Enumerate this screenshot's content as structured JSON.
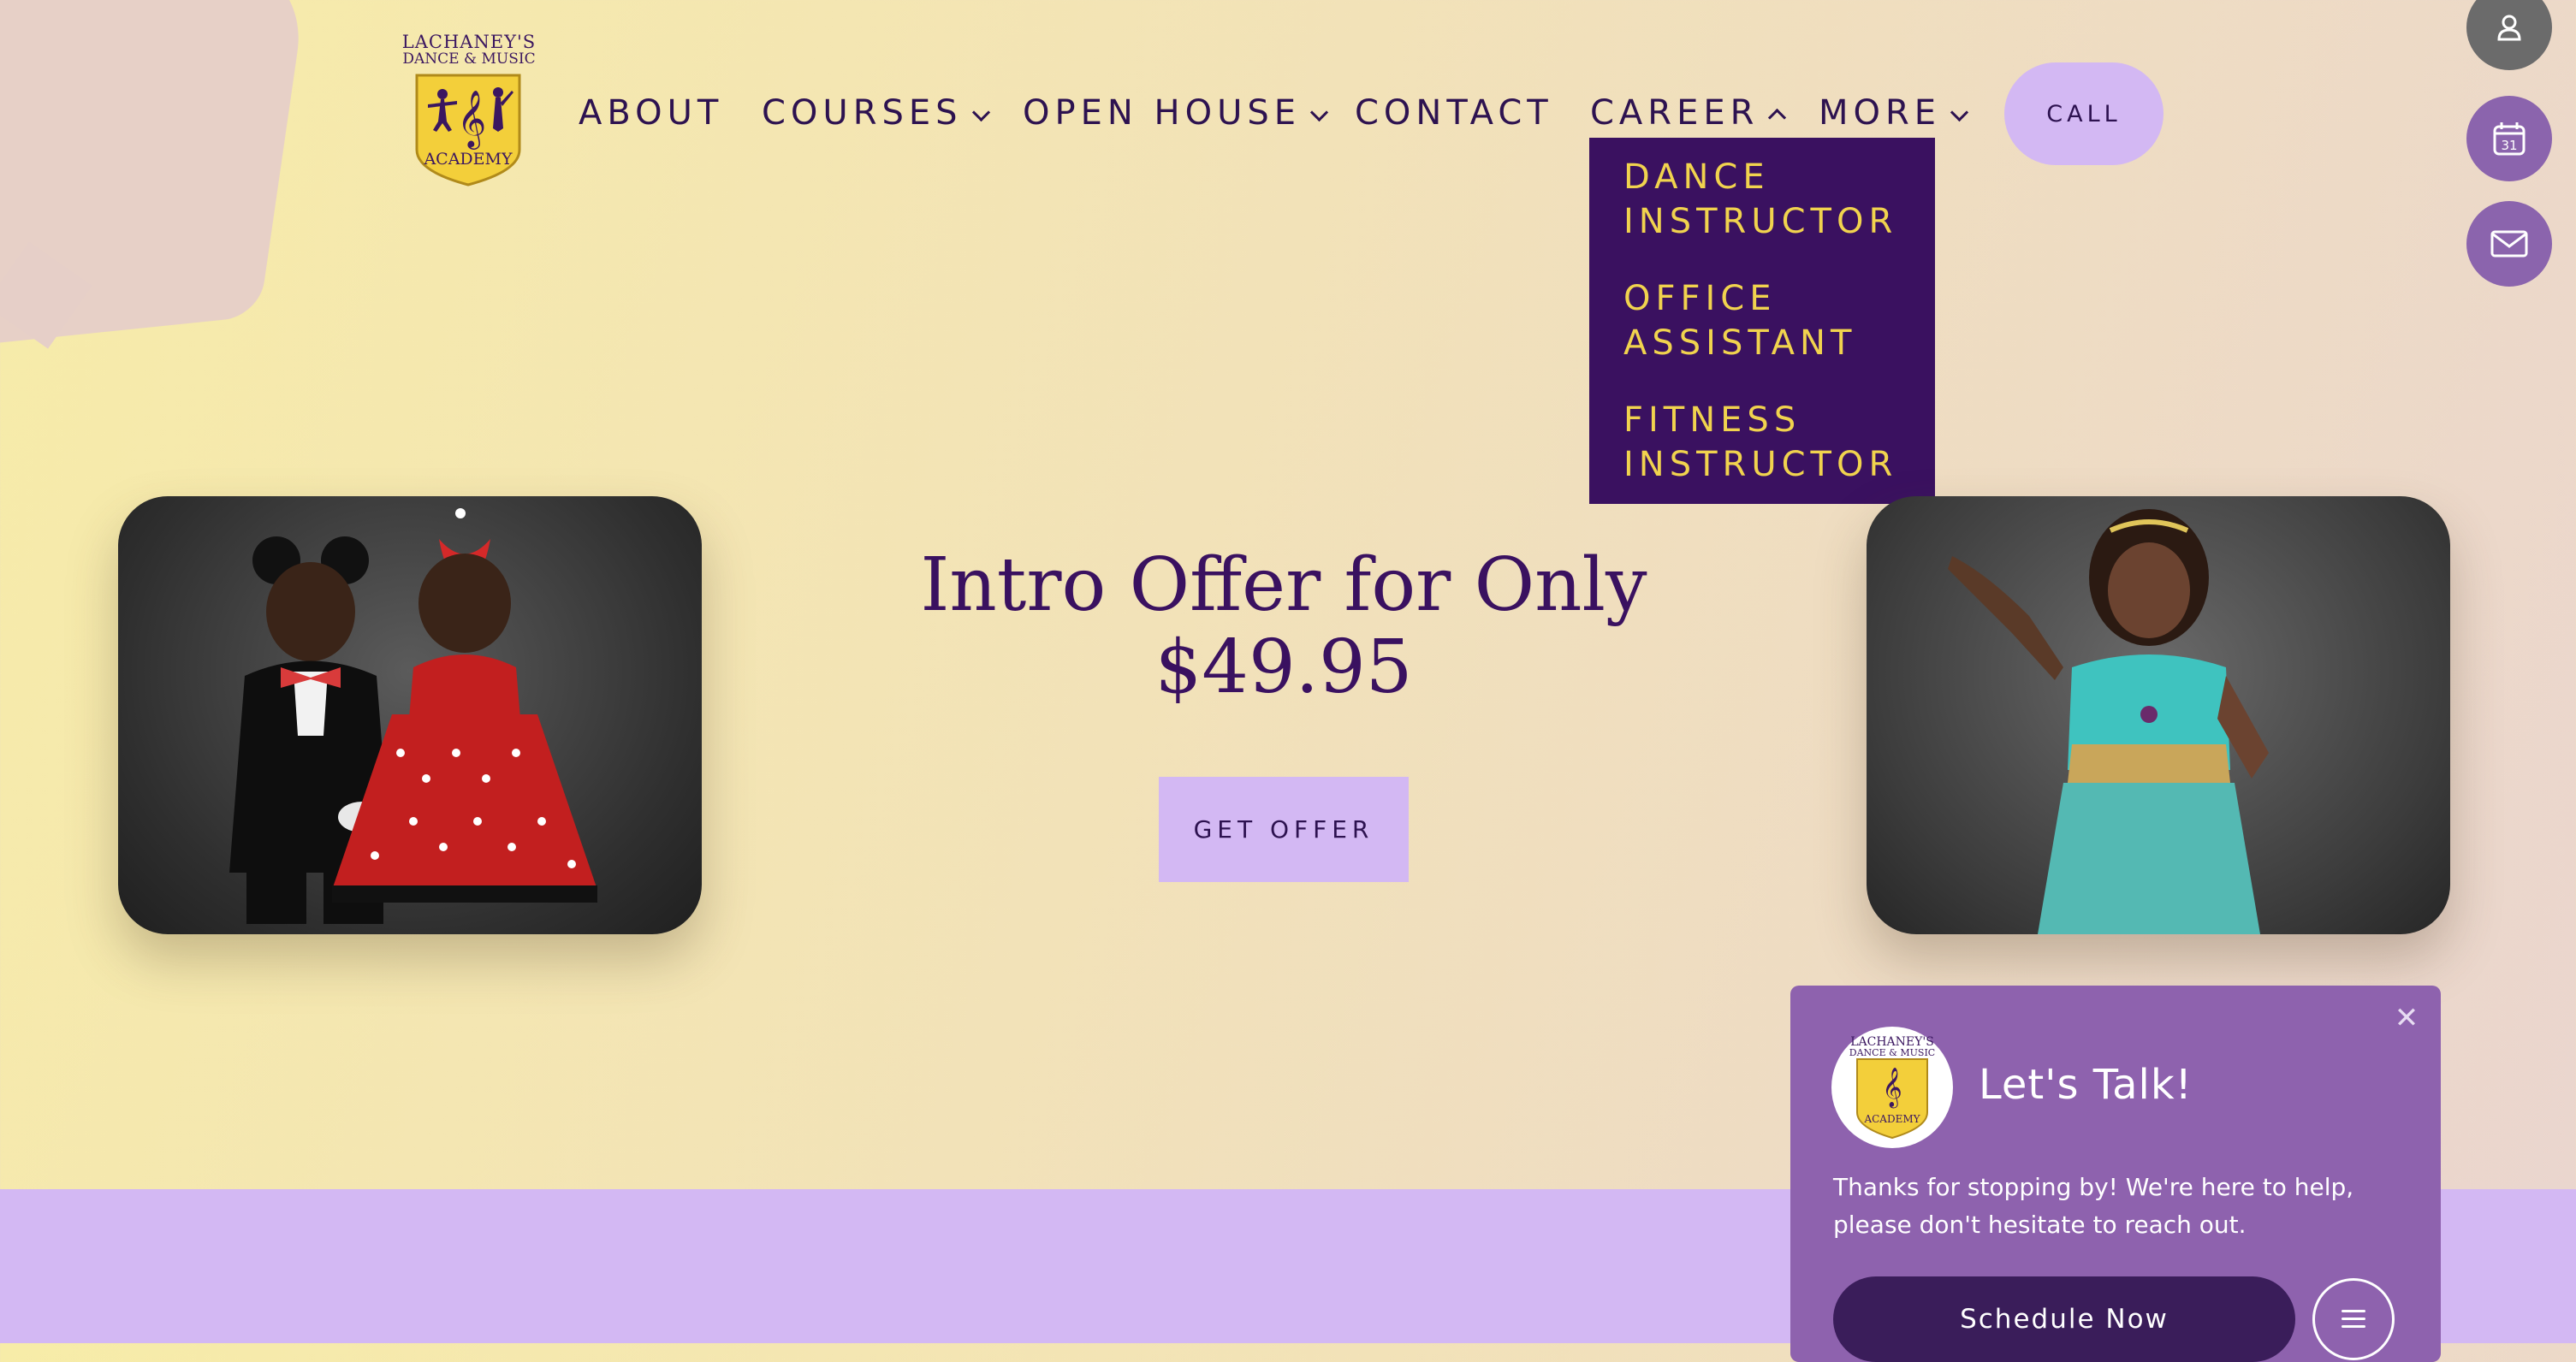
{
  "logo": {
    "line1": "LACHANEY'S",
    "line2": "DANCE & MUSIC",
    "line3": "ACADEMY"
  },
  "nav": {
    "items": [
      {
        "label": "ABOUT",
        "has_dropdown": false
      },
      {
        "label": "COURSES",
        "has_dropdown": true
      },
      {
        "label": "OPEN HOUSE",
        "has_dropdown": true
      },
      {
        "label": "CONTACT",
        "has_dropdown": false
      },
      {
        "label": "CAREER",
        "has_dropdown": true,
        "expanded": true
      },
      {
        "label": "MORE",
        "has_dropdown": true
      }
    ],
    "call_label": "CALL"
  },
  "career_dropdown": {
    "items": [
      "DANCE INSTRUCTOR",
      "OFFICE ASSISTANT",
      "FITNESS INSTRUCTOR"
    ]
  },
  "side_buttons": {
    "icons": [
      "user-icon",
      "calendar-icon",
      "mail-icon"
    ],
    "calendar_day": "31"
  },
  "hero": {
    "title_line1": "Intro Offer for Only",
    "title_line2": "$49.95",
    "cta_label": "GET OFFER"
  },
  "chat": {
    "title": "Let's Talk!",
    "message": "Thanks for stopping by! We're here to help, please don't hesitate to reach out.",
    "schedule_label": "Schedule Now",
    "close_symbol": "✕"
  },
  "colors": {
    "primary_purple": "#3a1160",
    "lavender": "#d3b8f3",
    "gold": "#f1d34e",
    "chat_purple": "#8e62ae"
  }
}
